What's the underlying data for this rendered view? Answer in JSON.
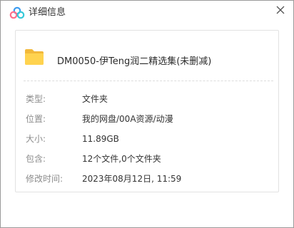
{
  "window": {
    "title": "详细信息",
    "logo_icon": "baidu-netdisk-logo-icon",
    "close_icon": "close-icon"
  },
  "file": {
    "icon": "folder-icon",
    "name": "DM0050-伊Teng润二精选集(未删减)"
  },
  "details": {
    "type": {
      "label": "类型:",
      "value": "文件夹"
    },
    "location": {
      "label": "位置:",
      "value": "我的网盘/00A资源/动漫"
    },
    "size": {
      "label": "大小:",
      "value": "11.89GB"
    },
    "contains": {
      "label": "包含:",
      "value": "12个文件,0个文件夹"
    },
    "modified": {
      "label": "修改时间:",
      "value": "2023年08月12日, 11:59"
    }
  },
  "colors": {
    "folder": "#ffd34f",
    "logo_blue": "#3a9bf0",
    "logo_pink": "#ff6e8a",
    "logo_cyan": "#35c9d9"
  }
}
